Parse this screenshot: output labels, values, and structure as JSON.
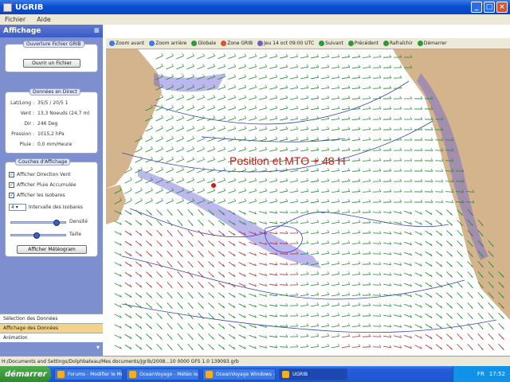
{
  "window": {
    "title": "UGRIB",
    "min": "_",
    "max": "□",
    "close": "×"
  },
  "menu": [
    "Fichier",
    "Aide"
  ],
  "panel": {
    "title": "Affichage",
    "collapse_icon": "double-chevron-up-icon",
    "group_file": {
      "title": "Ouverture Fichier GRIB",
      "button": "Ouvrir un Fichier"
    },
    "group_data": {
      "title": "Données en Direct",
      "rows": [
        {
          "k": "Lat/Long :",
          "v": "35/5 / 20/5 1"
        },
        {
          "k": "Vent :",
          "v": "13,3 Noeuds (24,7 m)"
        },
        {
          "k": "Dir :",
          "v": "246 Deg"
        },
        {
          "k": "Pression :",
          "v": "1015,2 hPa"
        },
        {
          "k": "Pluie :",
          "v": "0,0 mm/Heure"
        }
      ]
    },
    "group_layers": {
      "title": "Couches d'Affichage",
      "checks": [
        {
          "label": "Afficher Direction Vent",
          "checked": true
        },
        {
          "label": "Afficher Pluie Accumulée",
          "checked": true
        },
        {
          "label": "Afficher les Isobares",
          "checked": true
        }
      ],
      "interval_value": "4",
      "interval_label": "Intervalle des Isobares",
      "slider1_label": "Densité",
      "slider1_value": 0.85,
      "slider2_label": "Taille",
      "slider2_value": 0.45,
      "meteo_button": "Afficher Météogram"
    },
    "nav": [
      {
        "label": "Sélection des Données",
        "active": false
      },
      {
        "label": "Affichage des Données",
        "active": true
      },
      {
        "label": "Animation",
        "active": false
      }
    ]
  },
  "toolbar": {
    "items": [
      {
        "icon": "zoom-in-icon",
        "color": "#3a7be8",
        "label": "Zoom avant"
      },
      {
        "icon": "zoom-out-icon",
        "color": "#3a7be8",
        "label": "Zoom arrière"
      },
      {
        "icon": "globe-icon",
        "color": "#2d9a3a",
        "label": "Globale"
      },
      {
        "icon": "grib-zone-icon",
        "color": "#d9542c",
        "label": "Zone GRIB"
      },
      {
        "icon": "date-icon",
        "color": "#7a5ab8",
        "label": "Jeu 14 oct 09:00 UTC"
      },
      {
        "icon": "forward-icon",
        "color": "#2d9a3a",
        "label": "Suivant"
      },
      {
        "icon": "back-icon",
        "color": "#2d9a3a",
        "label": "Précédent"
      },
      {
        "icon": "refresh-icon",
        "color": "#2d9a3a",
        "label": "Rafraîchir"
      },
      {
        "icon": "play-icon",
        "color": "#2d9a3a",
        "label": "Démarrer"
      }
    ]
  },
  "map": {
    "annotation": "Position et MTO + 48 H",
    "annotation_color": "#d11a1a",
    "land_color": "#d4b48c",
    "wind_green": "#1c8a2c",
    "wind_red": "#b0302c",
    "isobar_color": "#3b45b0",
    "rain_color": "#6a5fd8"
  },
  "statusbar": "H:/Documents and Settings/Dolphbateau/Mes documents/Jgrib/2008...10 0000 GFS 1.0 139093.grb",
  "taskbar": {
    "start": "démarrer",
    "tasks": [
      {
        "label": "Forums - Modifier le Mes...",
        "active": false
      },
      {
        "label": "OceanVoyage - Météo le...",
        "active": false
      },
      {
        "label": "OceanVoyage Windows - Micro...",
        "active": false
      },
      {
        "label": "UGRIB",
        "active": true
      }
    ],
    "lang": "FR",
    "clock": "17:52"
  }
}
